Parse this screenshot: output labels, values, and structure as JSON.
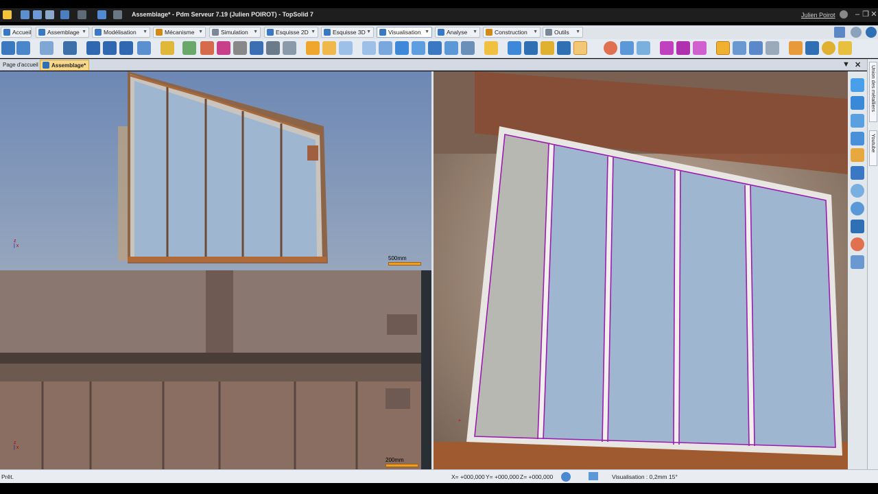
{
  "titlebar": {
    "title": "Assemblage* - Pdm Serveur 7.19 (Julien POIROT) - TopSolid 7",
    "user": "Julien Poirot"
  },
  "tabs": [
    {
      "label": "Accueil",
      "icon": "home-icon",
      "color": "#3a78c3"
    },
    {
      "label": "Assemblage",
      "icon": "assembly-icon",
      "color": "#3a78c3"
    },
    {
      "label": "Modélisation",
      "icon": "modeling-icon",
      "color": "#3a78c3"
    },
    {
      "label": "Mécanisme",
      "icon": "mechanism-icon",
      "color": "#d08a18"
    },
    {
      "label": "Simulation",
      "icon": "simulation-icon",
      "color": "#7a8898"
    },
    {
      "label": "Esquisse 2D",
      "icon": "sketch-2d-icon",
      "color": "#3a78c3"
    },
    {
      "label": "Esquisse 3D",
      "icon": "sketch-3d-icon",
      "color": "#3a78c3"
    },
    {
      "label": "Visualisation",
      "icon": "visualization-icon",
      "color": "#3a78c3"
    },
    {
      "label": "Analyse",
      "icon": "analysis-icon",
      "color": "#3a78c3"
    },
    {
      "label": "Construction",
      "icon": "construction-icon",
      "color": "#d08a18"
    },
    {
      "label": "Outils",
      "icon": "tools-icon",
      "color": "#7a8898"
    }
  ],
  "document_tabs": {
    "home": "Page d'accueil",
    "active": "Assemblage*"
  },
  "viewports": {
    "top_left_scale": "500mm",
    "bottom_left_scale": "200mm",
    "axis_x": "x",
    "axis_z": "z"
  },
  "side_panel": {
    "tab1": "Union des métalliers",
    "tab2": "Youtube"
  },
  "status": {
    "ready": "Prêt.",
    "x": "X= +000,000",
    "y": "Y= +000,000",
    "z": "Z= +000,000",
    "visualization": "Visualisation : 0,2mm 15°"
  },
  "colors": {
    "accent": "#3a78c3",
    "frame_highlight": "#9b1bb0",
    "glass": "#9eb6cf",
    "rust": "#b0642c"
  }
}
